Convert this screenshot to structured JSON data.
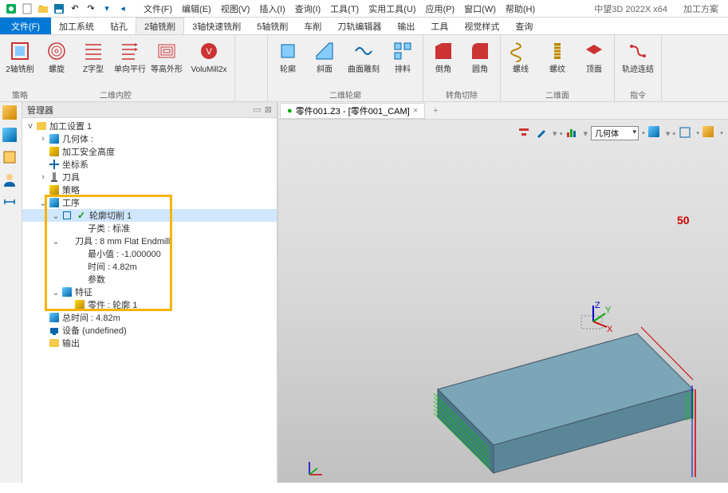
{
  "app": {
    "title": "中望3D 2022X x64",
    "doc_mode": "加工方案"
  },
  "menu": [
    "文件(F)",
    "编辑(E)",
    "视图(V)",
    "插入(I)",
    "查询(I)",
    "工具(T)",
    "实用工具(U)",
    "应用(P)",
    "窗口(W)",
    "帮助(H)"
  ],
  "ribbon": {
    "tabs": [
      "文件(F)",
      "加工系统",
      "钻孔",
      "2轴铣削",
      "3轴快速铣削",
      "5轴铣削",
      "车削",
      "刀轨编辑器",
      "输出",
      "工具",
      "视觉样式",
      "查询"
    ],
    "active_tab": "2轴铣削",
    "groups": [
      {
        "label": "策略",
        "items": [
          {
            "l": "2轴铣削"
          },
          {
            "l": "螺旋"
          },
          {
            "l": "Z字型"
          },
          {
            "l": "单向平行"
          },
          {
            "l": "等高外形"
          },
          {
            "l": "VoluMill2x"
          }
        ]
      },
      {
        "label": "二维内腔",
        "items": []
      },
      {
        "label": "二维轮廓",
        "items": [
          {
            "l": "轮廓"
          },
          {
            "l": "斜面"
          },
          {
            "l": "曲面雕刻"
          },
          {
            "l": "排料"
          }
        ]
      },
      {
        "label": "转角切除",
        "items": [
          {
            "l": "倒角"
          },
          {
            "l": "圆角"
          }
        ]
      },
      {
        "label": "二维面",
        "items": [
          {
            "l": "螺线"
          },
          {
            "l": "螺纹"
          },
          {
            "l": "顶面"
          }
        ]
      },
      {
        "label": "指令",
        "items": [
          {
            "l": "轨迹连结"
          }
        ]
      }
    ]
  },
  "manager": {
    "title": "管理器",
    "tree": {
      "root": "加工设置 1",
      "items": [
        {
          "ind": 1,
          "exp": ">",
          "icon": "cube",
          "label": "几何体 :"
        },
        {
          "ind": 1,
          "exp": "",
          "icon": "gold",
          "label": "加工安全高度"
        },
        {
          "ind": 1,
          "exp": "",
          "icon": "cs",
          "label": "坐标系"
        },
        {
          "ind": 1,
          "exp": ">",
          "icon": "tool",
          "label": "刀具"
        },
        {
          "ind": 1,
          "exp": "",
          "icon": "gold",
          "label": "策略"
        },
        {
          "ind": 1,
          "exp": "v",
          "icon": "cube",
          "label": "工序",
          "hl": true
        },
        {
          "ind": 2,
          "exp": "v",
          "icon": "check",
          "label": "轮廓切削 1",
          "sel": true,
          "hl": true,
          "prefix_sq": true
        },
        {
          "ind": 3,
          "exp": "",
          "icon": "",
          "label": "子类 : 标准",
          "hl": true
        },
        {
          "ind": 2,
          "exp": "v",
          "icon": "",
          "label": "刀具 : 8 mm Flat Endmill",
          "hl": true
        },
        {
          "ind": 3,
          "exp": "",
          "icon": "",
          "label": "最小值 : -1.000000",
          "hl": true
        },
        {
          "ind": 3,
          "exp": "",
          "icon": "",
          "label": "时间 : 4.82m",
          "hl": true
        },
        {
          "ind": 3,
          "exp": "",
          "icon": "",
          "label": "参数",
          "hl": true
        },
        {
          "ind": 2,
          "exp": "v",
          "icon": "cube",
          "label": "特征",
          "hl": true
        },
        {
          "ind": 3,
          "exp": "",
          "icon": "gold",
          "label": "零件 : 轮廓 1",
          "hl": true
        },
        {
          "ind": 1,
          "exp": "",
          "icon": "cube",
          "label": "总时间 : 4.82m"
        },
        {
          "ind": 1,
          "exp": "",
          "icon": "dev",
          "label": "设备 (undefined)"
        },
        {
          "ind": 1,
          "exp": "",
          "icon": "folder",
          "label": "输出"
        }
      ]
    }
  },
  "document": {
    "tab_label": "零件001.Z3 - [零件001_CAM]"
  },
  "viewport": {
    "toolbar_dropdown": "几何体",
    "dimension": "50"
  }
}
